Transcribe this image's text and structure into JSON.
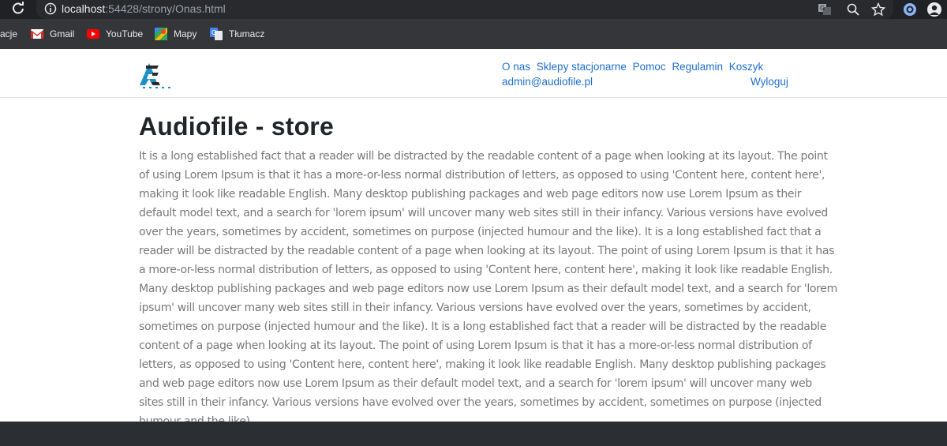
{
  "browser": {
    "url_host": "localhost",
    "url_rest": ":54428/strony/Onas.html",
    "icons": [
      "reload-icon",
      "info-icon",
      "translate-icon",
      "zoom-icon",
      "bookmark-star-icon",
      "extension-icon",
      "profile-icon"
    ]
  },
  "bookmarks": {
    "partial_label": "acje",
    "items": [
      {
        "label": "Gmail",
        "icon": "gmail-icon"
      },
      {
        "label": "YouTube",
        "icon": "youtube-icon"
      },
      {
        "label": "Mapy",
        "icon": "maps-icon"
      },
      {
        "label": "Tłumacz",
        "icon": "translate-icon"
      }
    ]
  },
  "nav": {
    "links": [
      "O nas",
      "Sklepy stacjonarne",
      "Pomoc",
      "Regulamin",
      "Koszyk",
      "admin@audiofile.pl"
    ],
    "logout": "Wyloguj"
  },
  "main": {
    "title": "Audiofile - store",
    "body": "It is a long established fact that a reader will be distracted by the readable content of a page when looking at its layout. The point of using Lorem Ipsum is that it has a more-or-less normal distribution of letters, as opposed to using 'Content here, content here', making it look like readable English. Many desktop publishing packages and web page editors now use Lorem Ipsum as their default model text, and a search for 'lorem ipsum' will uncover many web sites still in their infancy. Various versions have evolved over the years, sometimes by accident, sometimes on purpose (injected humour and the like). It is a long established fact that a reader will be distracted by the readable content of a page when looking at its layout. The point of using Lorem Ipsum is that it has a more-or-less normal distribution of letters, as opposed to using 'Content here, content here', making it look like readable English. Many desktop publishing packages and web page editors now use Lorem Ipsum as their default model text, and a search for 'lorem ipsum' will uncover many web sites still in their infancy. Various versions have evolved over the years, sometimes by accident, sometimes on purpose (injected humour and the like). It is a long established fact that a reader will be distracted by the readable content of a page when looking at its layout. The point of using Lorem Ipsum is that it has a more-or-less normal distribution of letters, as opposed to using 'Content here, content here', making it look like readable English. Many desktop publishing packages and web page editors now use Lorem Ipsum as their default model text, and a search for 'lorem ipsum' will uncover many web sites still in their infancy. Various versions have evolved over the years, sometimes by accident, sometimes on purpose (injected humour and the like)."
  },
  "colors": {
    "link": "#1f6fd0",
    "logo_accent": "#1e90c8",
    "footer": "#2b2f34",
    "chrome_dark": "#202124"
  }
}
